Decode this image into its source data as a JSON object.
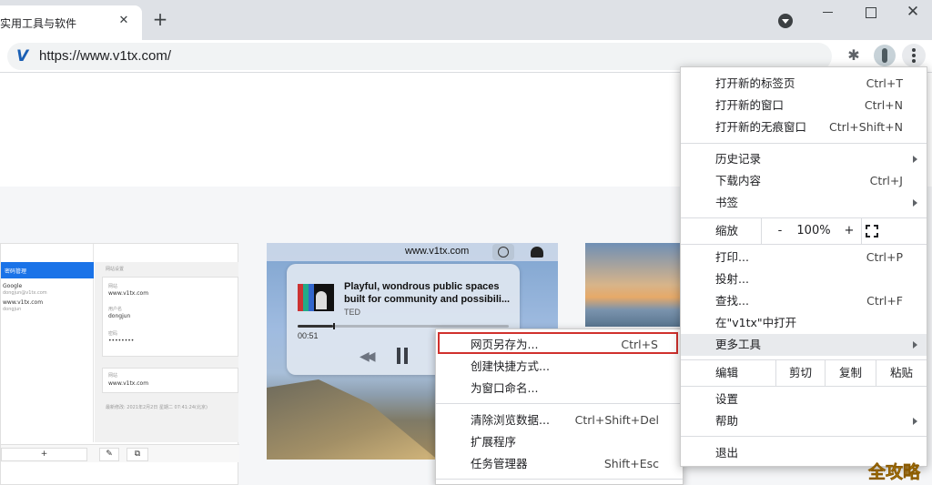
{
  "browser": {
    "tab_title": "实用工具与软件",
    "tab_close": "✕",
    "new_tab": "+",
    "window_close": "✕",
    "url": "https://www.v1tx.com/",
    "site_icon_letter": "V"
  },
  "shot1": {
    "sidebar_header": "密码管理",
    "items": [
      {
        "title": "Google",
        "sub": "dongjun@v1tx.com"
      },
      {
        "title": "www.v1tx.com",
        "sub": "dongjun"
      }
    ],
    "main_title": "网站设置",
    "fields": [
      {
        "label": "网站",
        "value": "www.v1tx.com"
      },
      {
        "label": "用户名",
        "value": "dongjun"
      },
      {
        "label": "密码",
        "value": "••••••••"
      }
    ],
    "card2_label": "网站",
    "card2_value": "www.v1tx.com",
    "footer_note": "最新修改: 2021年2月2日 星期二 07:41:24(北京)",
    "add_btn": "+",
    "edit_btn": "✎",
    "copy_btn": "⧉"
  },
  "shot2": {
    "bar_url": "www.v1tx.com",
    "title": "Playful, wondrous public spaces built for community and possibili...",
    "title_line1": "Playful, wondrous public spaces",
    "title_line2": "built for community and possibili...",
    "source": "TED",
    "time": "00:51",
    "progress": 0.17,
    "rewind": "◀◀"
  },
  "context_menu": {
    "items": [
      {
        "label": "网页另存为...",
        "shortcut": "Ctrl+S",
        "highlighted": true
      },
      {
        "label": "创建快捷方式...",
        "shortcut": ""
      },
      {
        "label": "为窗口命名...",
        "shortcut": ""
      },
      {
        "label": "清除浏览数据...",
        "shortcut": "Ctrl+Shift+Del"
      },
      {
        "label": "扩展程序",
        "shortcut": ""
      },
      {
        "label": "任务管理器",
        "shortcut": "Shift+Esc"
      }
    ]
  },
  "main_menu": {
    "new_tab": {
      "label": "打开新的标签页",
      "shortcut": "Ctrl+T"
    },
    "new_window": {
      "label": "打开新的窗口",
      "shortcut": "Ctrl+N"
    },
    "incognito": {
      "label": "打开新的无痕窗口",
      "shortcut": "Ctrl+Shift+N"
    },
    "history": {
      "label": "历史记录"
    },
    "downloads": {
      "label": "下载内容",
      "shortcut": "Ctrl+J"
    },
    "bookmarks": {
      "label": "书签"
    },
    "zoom": {
      "label": "缩放",
      "minus": "-",
      "value": "100%",
      "plus": "+"
    },
    "print": {
      "label": "打印...",
      "shortcut": "Ctrl+P"
    },
    "cast": {
      "label": "投射..."
    },
    "find": {
      "label": "查找...",
      "shortcut": "Ctrl+F"
    },
    "open_in": {
      "label": "在\"v1tx\"中打开"
    },
    "more_tools": {
      "label": "更多工具"
    },
    "edit": {
      "label": "编辑",
      "cut": "剪切",
      "copy": "复制",
      "paste": "粘贴"
    },
    "settings": {
      "label": "设置"
    },
    "help": {
      "label": "帮助"
    },
    "exit": {
      "label": "退出"
    }
  },
  "watermark": "全攻略",
  "colors": {
    "highlight_border": "#d0312d",
    "accent": "#1a73e8"
  }
}
